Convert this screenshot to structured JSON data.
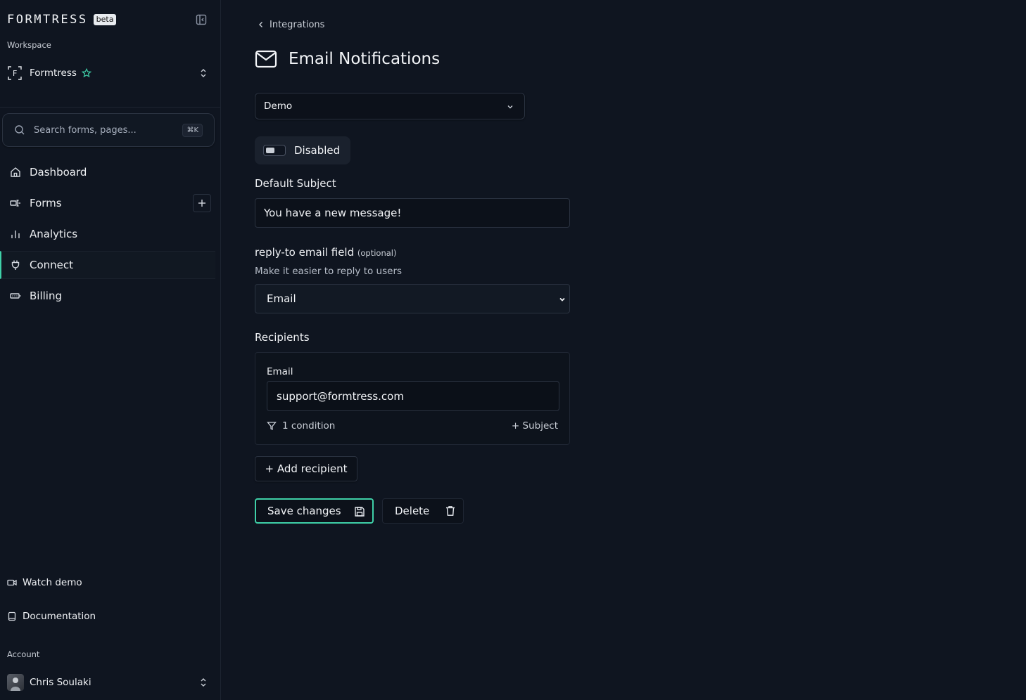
{
  "brand": {
    "name": "FORMTRESS",
    "badge": "beta"
  },
  "sidebar": {
    "workspace_label": "Workspace",
    "workspace": {
      "initial": "F",
      "name": "Formtress"
    },
    "search": {
      "placeholder": "Search forms, pages...",
      "shortcut": "⌘K"
    },
    "nav": [
      {
        "label": "Dashboard",
        "icon": "home-icon"
      },
      {
        "label": "Forms",
        "icon": "forms-icon"
      },
      {
        "label": "Analytics",
        "icon": "bar-chart-icon"
      },
      {
        "label": "Connect",
        "icon": "plug-icon",
        "active": true
      },
      {
        "label": "Billing",
        "icon": "battery-icon"
      }
    ],
    "bottom_links": [
      {
        "label": "Watch demo",
        "icon": "video-icon"
      },
      {
        "label": "Documentation",
        "icon": "book-icon"
      }
    ],
    "account_label": "Account",
    "account": {
      "name": "Chris Soulaki"
    }
  },
  "main": {
    "breadcrumb": "Integrations",
    "title": "Email Notifications",
    "form_select": {
      "value": "Demo"
    },
    "toggle": {
      "label": "Disabled",
      "enabled": false
    },
    "default_subject": {
      "label": "Default Subject",
      "value": "You have a new message!"
    },
    "reply_to": {
      "label": "reply-to email field",
      "optional": "(optional)",
      "help": "Make it easier to reply to users",
      "value": "Email"
    },
    "recipients": {
      "label": "Recipients",
      "items": [
        {
          "field_label": "Email",
          "value": "support@formtress.com",
          "condition": "1 condition",
          "subject_action": "+ Subject"
        }
      ],
      "add_label": "+ Add recipient"
    },
    "actions": {
      "save_label": "Save changes",
      "delete_label": "Delete"
    }
  },
  "colors": {
    "accent": "#3fd0a8",
    "background": "#0f1520",
    "border": "#2a3240"
  }
}
